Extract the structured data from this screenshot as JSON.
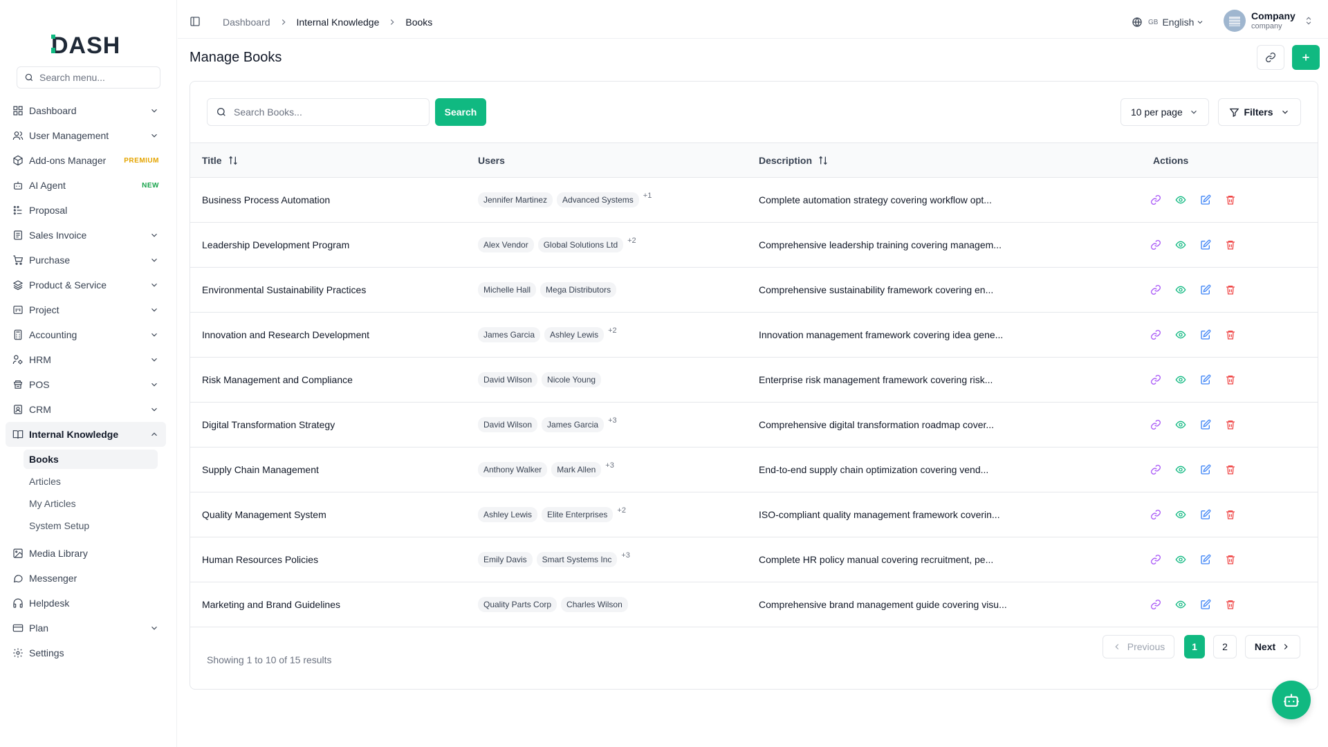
{
  "brand": {
    "logo_text": "DASH",
    "accent": "#10b981"
  },
  "sidebar": {
    "search_placeholder": "Search menu...",
    "items": [
      {
        "label": "Dashboard",
        "icon": "grid-icon",
        "chevron": true
      },
      {
        "label": "User Management",
        "icon": "users-icon",
        "chevron": true
      },
      {
        "label": "Add-ons Manager",
        "icon": "package-icon",
        "badge": "PREMIUM"
      },
      {
        "label": "AI Agent",
        "icon": "bot-icon",
        "badge": "NEW"
      },
      {
        "label": "Proposal",
        "icon": "proposal-icon"
      },
      {
        "label": "Sales Invoice",
        "icon": "invoice-icon",
        "chevron": true
      },
      {
        "label": "Purchase",
        "icon": "cart-icon",
        "chevron": true
      },
      {
        "label": "Product & Service",
        "icon": "layers-icon",
        "chevron": true
      },
      {
        "label": "Project",
        "icon": "project-icon",
        "chevron": true
      },
      {
        "label": "Accounting",
        "icon": "calculator-icon",
        "chevron": true
      },
      {
        "label": "HRM",
        "icon": "hrm-icon",
        "chevron": true
      },
      {
        "label": "POS",
        "icon": "pos-icon",
        "chevron": true
      },
      {
        "label": "CRM",
        "icon": "crm-icon",
        "chevron": true
      },
      {
        "label": "Internal Knowledge",
        "icon": "book-open-icon",
        "chevron": true,
        "expanded": true
      },
      {
        "label": "Media Library",
        "icon": "image-icon"
      },
      {
        "label": "Messenger",
        "icon": "message-icon"
      },
      {
        "label": "Helpdesk",
        "icon": "headphones-icon"
      },
      {
        "label": "Plan",
        "icon": "credit-card-icon",
        "chevron": true
      },
      {
        "label": "Settings",
        "icon": "gear-icon"
      }
    ],
    "sub_items": [
      "Books",
      "Articles",
      "My Articles",
      "System Setup"
    ]
  },
  "topbar": {
    "breadcrumb": [
      "Dashboard",
      "Internal Knowledge",
      "Books"
    ],
    "language_flag": "GB",
    "language": "English",
    "company_name": "Company",
    "company_sub": "company"
  },
  "page": {
    "title": "Manage Books",
    "search_placeholder": "Search Books...",
    "search_button": "Search",
    "per_page": "10 per page",
    "filters": "Filters"
  },
  "table": {
    "columns": [
      "Title",
      "Users",
      "Description",
      "Actions"
    ],
    "rows": [
      {
        "title": "Business Process Automation",
        "users": [
          "Jennifer Martinez",
          "Advanced Systems"
        ],
        "more": "+1",
        "description": "Complete automation strategy covering workflow opt..."
      },
      {
        "title": "Leadership Development Program",
        "users": [
          "Alex Vendor",
          "Global Solutions Ltd"
        ],
        "more": "+2",
        "description": "Comprehensive leadership training covering managem..."
      },
      {
        "title": "Environmental Sustainability Practices",
        "users": [
          "Michelle Hall",
          "Mega Distributors"
        ],
        "more": "",
        "description": "Comprehensive sustainability framework covering en..."
      },
      {
        "title": "Innovation and Research Development",
        "users": [
          "James Garcia",
          "Ashley Lewis"
        ],
        "more": "+2",
        "description": "Innovation management framework covering idea gene..."
      },
      {
        "title": "Risk Management and Compliance",
        "users": [
          "David Wilson",
          "Nicole Young"
        ],
        "more": "",
        "description": "Enterprise risk management framework covering risk..."
      },
      {
        "title": "Digital Transformation Strategy",
        "users": [
          "David Wilson",
          "James Garcia"
        ],
        "more": "+3",
        "description": "Comprehensive digital transformation roadmap cover..."
      },
      {
        "title": "Supply Chain Management",
        "users": [
          "Anthony Walker",
          "Mark Allen"
        ],
        "more": "+3",
        "description": "End-to-end supply chain optimization covering vend..."
      },
      {
        "title": "Quality Management System",
        "users": [
          "Ashley Lewis",
          "Elite Enterprises"
        ],
        "more": "+2",
        "description": "ISO-compliant quality management framework coverin..."
      },
      {
        "title": "Human Resources Policies",
        "users": [
          "Emily Davis",
          "Smart Systems Inc"
        ],
        "more": "+3",
        "description": "Complete HR policy manual covering recruitment, pe..."
      },
      {
        "title": "Marketing and Brand Guidelines",
        "users": [
          "Quality Parts Corp",
          "Charles Wilson"
        ],
        "more": "",
        "description": "Comprehensive brand management guide covering visu..."
      }
    ]
  },
  "pagination": {
    "info": "Showing 1 to 10 of 15 results",
    "previous": "Previous",
    "pages": [
      "1",
      "2"
    ],
    "next": "Next"
  },
  "colors": {
    "link": "#a855f7",
    "view": "#10b981",
    "edit": "#3b82f6",
    "delete": "#ef4444",
    "premium": "#e4a400",
    "new": "#16a34a"
  }
}
